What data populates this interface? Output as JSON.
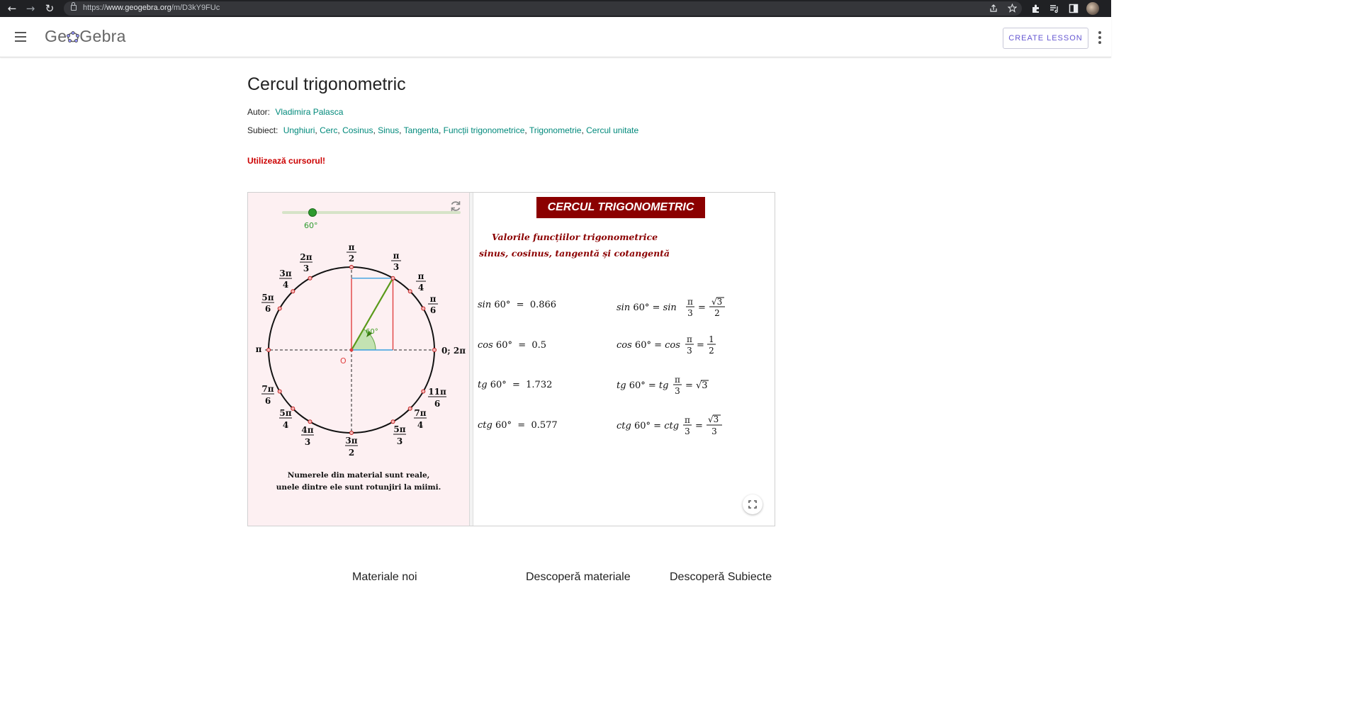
{
  "browser": {
    "url_prefix": "https://",
    "url_host": "www.geogebra.org",
    "url_path": "/m/D3kY9FUc",
    "back_icon": "←",
    "forward_icon": "→",
    "reload_icon": "↻"
  },
  "header": {
    "logo_part1": "Ge",
    "logo_part2": "Gebra",
    "create_lesson": "CREATE LESSON"
  },
  "page": {
    "title": "Cercul trigonometric",
    "author_label": "Autor:",
    "author": "Vladimira Palasca",
    "subject_label": "Subiect:",
    "subjects": [
      "Unghiuri",
      "Cerc",
      "Cosinus",
      "Sinus",
      "Tangenta",
      "Funcții trigonometrice",
      "Trigonometrie",
      "Cercul unitate"
    ],
    "instruction": "Utilizează cursorul!"
  },
  "applet": {
    "slider_value": "60°",
    "slider_fraction": 0.17,
    "angle_label": "60°",
    "origin_label": "O",
    "note_line1": "Numerele din material sunt reale,",
    "note_line2": "unele dintre ele sunt rotunjiri la miimi.",
    "banner": "CERCUL TRIGONOMETRIC",
    "subtitle_line1": "Valorile funcțiilor trigonometrice",
    "subtitle_line2": "sinus, cosinus, tangentă și cotangentă",
    "formulas_left": [
      {
        "fn": "sin",
        "arg": "60°",
        "value": "0.866"
      },
      {
        "fn": "cos",
        "arg": "60°",
        "value": "0.5"
      },
      {
        "fn": "tg",
        "arg": "60°",
        "value": "1.732"
      },
      {
        "fn": "ctg",
        "arg": "60°",
        "value": "0.577"
      }
    ],
    "circle_labels": [
      {
        "num": "π",
        "den": "2"
      },
      {
        "num": "π",
        "den": "3"
      },
      {
        "num": "π",
        "den": "4"
      },
      {
        "num": "π",
        "den": "6"
      },
      {
        "num": "2π",
        "den": "3"
      },
      {
        "num": "3π",
        "den": "4"
      },
      {
        "num": "5π",
        "den": "6"
      },
      {
        "num": "7π",
        "den": "6"
      },
      {
        "num": "5π",
        "den": "4"
      },
      {
        "num": "4π",
        "den": "3"
      },
      {
        "num": "3π",
        "den": "2"
      },
      {
        "num": "5π",
        "den": "3"
      },
      {
        "num": "7π",
        "den": "4"
      },
      {
        "num": "11π",
        "den": "6"
      }
    ],
    "label_pi": "π",
    "label_zero": "0; 2π"
  },
  "footer": {
    "links": [
      "Materiale noi",
      "Descoperă materiale",
      "Descoperă Subiecte"
    ]
  },
  "colors": {
    "accent": "#00897b",
    "brand_button": "#6557d2",
    "warning": "#cc0000",
    "banner_bg": "#8b0000",
    "slider_green": "#2e9a2e",
    "left_panel_bg": "#fdf0f2"
  }
}
